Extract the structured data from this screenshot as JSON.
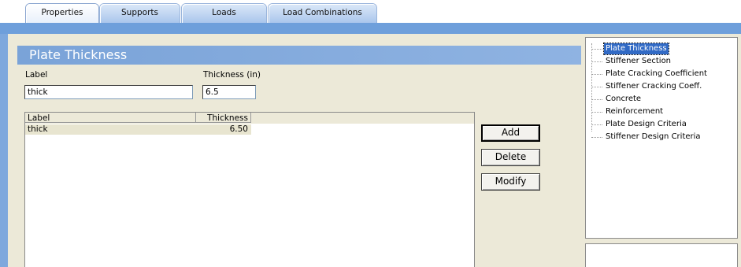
{
  "tabs": [
    {
      "label": "Properties"
    },
    {
      "label": "Supports"
    },
    {
      "label": "Loads"
    },
    {
      "label": "Load Combinations"
    }
  ],
  "section": {
    "title": "Plate Thickness"
  },
  "form": {
    "label_caption": "Label",
    "label_value": "thick",
    "thickness_caption": "Thickness (in)",
    "thickness_value": "6.5"
  },
  "list": {
    "columns": [
      "Label",
      "Thickness"
    ],
    "rows": [
      {
        "label": "thick",
        "thickness": "6.50"
      }
    ]
  },
  "buttons": {
    "add": "Add",
    "delete": "Delete",
    "modify": "Modify"
  },
  "tree": {
    "items": [
      {
        "label": "Plate Thickness",
        "selected": true
      },
      {
        "label": "Stiffener Section"
      },
      {
        "label": "Plate Cracking Coefficient"
      },
      {
        "label": "Stiffener Cracking Coeff."
      },
      {
        "label": "Concrete"
      },
      {
        "label": "Reinforcement"
      },
      {
        "label": "Plate Design Criteria"
      },
      {
        "label": "Stiffener Design Criteria"
      }
    ]
  },
  "colors": {
    "accent_blue": "#6e9fdb",
    "panel_bg": "#ece9d8",
    "selection": "#316ac5"
  }
}
